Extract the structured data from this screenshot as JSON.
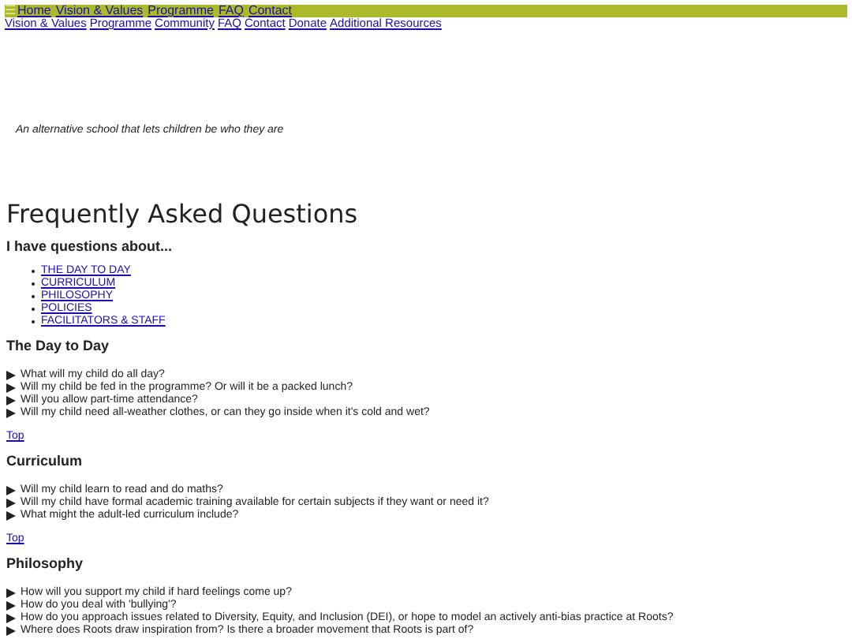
{
  "topbar": {
    "menu_icon": "☰",
    "links": [
      "Home",
      "Vision & Values",
      "Programme",
      "FAQ",
      "Contact"
    ]
  },
  "subnav": {
    "links": [
      "Vision & Values",
      "Programme",
      "Community",
      "FAQ",
      "Contact",
      "Donate",
      "Additional Resources"
    ]
  },
  "tagline": "An alternative school that lets children be who they are",
  "title": "Frequently Asked Questions",
  "toc": {
    "heading": "I have questions about...",
    "links": [
      "THE DAY TO DAY",
      "CURRICULUM",
      "PHILOSOPHY",
      "POLICIES",
      "FACILITATORS & STAFF"
    ]
  },
  "sections": [
    {
      "heading": "The Day to Day",
      "questions": [
        {
          "text": "What will my child do all day?",
          "expanded": false
        },
        {
          "text": "Will my child be fed in the programme? Or will it be a packed lunch?",
          "expanded": false
        },
        {
          "text": "Will you allow part-time attendance?",
          "expanded": false
        },
        {
          "text": "Will my child need all-weather clothes, or can they go inside when it's cold and wet?",
          "expanded": false
        }
      ],
      "top_link": "Top"
    },
    {
      "heading": "Curriculum",
      "questions": [
        {
          "text": "Will my child learn to read and do maths?",
          "expanded": false
        },
        {
          "text": "Will my child have formal academic training available for certain subjects if they want or need it?",
          "expanded": false
        },
        {
          "text": "What might the adult-led curriculum include?",
          "expanded": false
        }
      ],
      "top_link": "Top"
    },
    {
      "heading": "Philosophy",
      "questions": [
        {
          "text": "How will you support my child if hard feelings come up?",
          "expanded": false
        },
        {
          "text": "How do you deal with 'bullying'?",
          "expanded": false
        },
        {
          "text": "How do you approach issues related to Diversity, Equity, and Inclusion (DEI), or hope to model an actively anti-bias practice at Roots?",
          "expanded": false
        },
        {
          "text": "Where does Roots draw inspiration from? Is there a broader movement that Roots is part of?",
          "expanded": false
        }
      ]
    }
  ]
}
